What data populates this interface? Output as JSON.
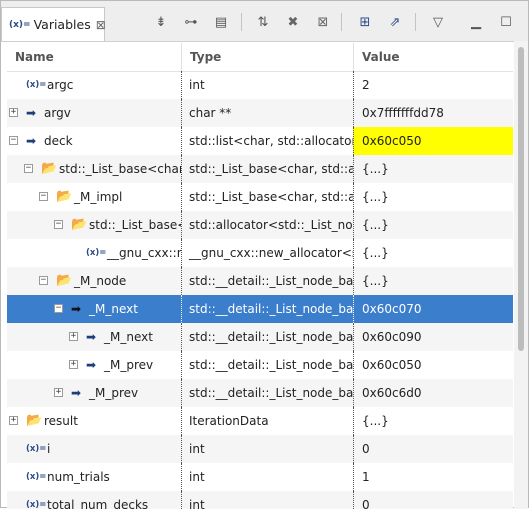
{
  "tab": {
    "icon": "(x)=",
    "title": "Variables",
    "close": "⊠"
  },
  "toolbar": [
    {
      "name": "collapse-all-icon",
      "glyph": "⇟"
    },
    {
      "name": "show-type-names-icon",
      "glyph": "⊶"
    },
    {
      "name": "show-logical-structure-icon",
      "glyph": "▤"
    },
    {
      "name": "select-all-icon",
      "glyph": "⇅"
    },
    {
      "name": "remove-icon",
      "glyph": "✖"
    },
    {
      "name": "remove-all-icon",
      "glyph": "⊠"
    },
    {
      "name": "new-expression-icon",
      "glyph": "⊞"
    },
    {
      "name": "export-icon",
      "glyph": "⇗"
    },
    {
      "name": "view-menu-icon",
      "glyph": "▽"
    },
    {
      "name": "minimize-icon",
      "glyph": "▁"
    },
    {
      "name": "maximize-icon",
      "glyph": "☐"
    }
  ],
  "columns": {
    "name": "Name",
    "type": "Type",
    "value": "Value"
  },
  "rows": [
    {
      "expander": "",
      "icon": "var",
      "name": "argc",
      "type": "int",
      "value": "2"
    },
    {
      "expander": "+",
      "icon": "arrow",
      "name": "argv",
      "type": "char **",
      "value": "0x7fffffffdd78"
    },
    {
      "expander": "−",
      "icon": "arrow",
      "name": "deck",
      "type": "std::list<char, std::allocator<c",
      "value": "0x60c050",
      "highlight": "#ffff00"
    },
    {
      "expander": "−",
      "icon": "folder",
      "name": "std::_List_base<char,",
      "type": "std::_List_base<char, std::allo",
      "value": "{...}"
    },
    {
      "expander": "−",
      "icon": "folder",
      "name": "_M_impl",
      "type": "std::_List_base<char, std::allo",
      "value": "{...}"
    },
    {
      "expander": "−",
      "icon": "folder",
      "name": "std::_List_base<",
      "type": "std::allocator<std::_List_node",
      "value": "{...}"
    },
    {
      "expander": "",
      "icon": "var",
      "name": "__gnu_cxx::n",
      "type": "__gnu_cxx::new_allocator<st",
      "value": "{...}"
    },
    {
      "expander": "−",
      "icon": "folder",
      "name": "_M_node",
      "type": "std::__detail::_List_node_bas",
      "value": "{...}"
    },
    {
      "expander": "−",
      "icon": "arrow",
      "name": "_M_next",
      "type": "std::__detail::_List_node_bas",
      "value": "0x60c070",
      "selected": true
    },
    {
      "expander": "+",
      "icon": "arrow",
      "name": "_M_next",
      "type": "std::__detail::_List_node_bas",
      "value": "0x60c090"
    },
    {
      "expander": "+",
      "icon": "arrow",
      "name": "_M_prev",
      "type": "std::__detail::_List_node_bas",
      "value": "0x60c050"
    },
    {
      "expander": "+",
      "icon": "arrow",
      "name": "_M_prev",
      "type": "std::__detail::_List_node_bas",
      "value": "0x60c6d0"
    },
    {
      "expander": "+",
      "icon": "folder",
      "name": "result",
      "type": "IterationData",
      "value": "{...}"
    },
    {
      "expander": "",
      "icon": "var",
      "name": "i",
      "type": "int",
      "value": "0"
    },
    {
      "expander": "",
      "icon": "var",
      "name": "num_trials",
      "type": "int",
      "value": "1"
    },
    {
      "expander": "",
      "icon": "var",
      "name": "total_num_decks",
      "type": "int",
      "value": "0"
    }
  ]
}
